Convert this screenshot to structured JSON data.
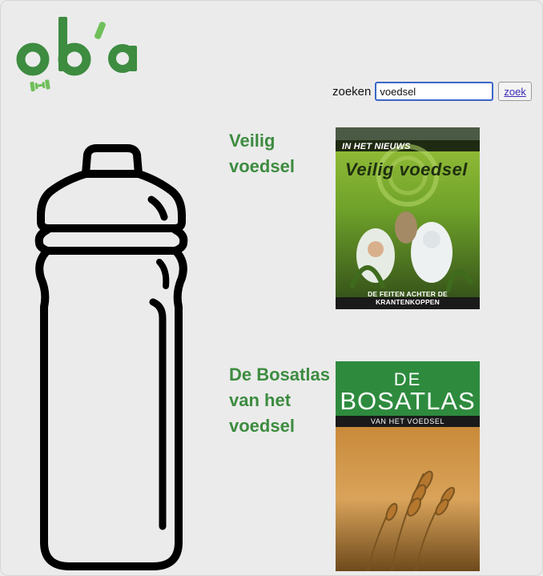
{
  "logo": {
    "text": "ob'a",
    "alt": "oba",
    "color": "#3d8c40"
  },
  "search": {
    "label": "zoeken",
    "value": "voedsel",
    "button_label": "zoek"
  },
  "illustration": {
    "icon": "water-bottle-icon"
  },
  "results": [
    {
      "title": "Veilig voedsel",
      "cover": {
        "strap": "IN HET NIEUWS",
        "title": "Veilig voedsel",
        "footer": "DE FEITEN ACHTER DE KRANTENKOPPEN",
        "background": "#7fb02e"
      }
    },
    {
      "title": "De Bosatlas van het voedsel",
      "cover": {
        "line1": "DE",
        "title": "BOSATLAS",
        "subtitle": "VAN HET VOEDSEL",
        "background": "#2e8b3e"
      }
    }
  ],
  "colors": {
    "accent": "#3d8c40",
    "background": "#ebebeb",
    "input_focus": "#3a67c8"
  }
}
